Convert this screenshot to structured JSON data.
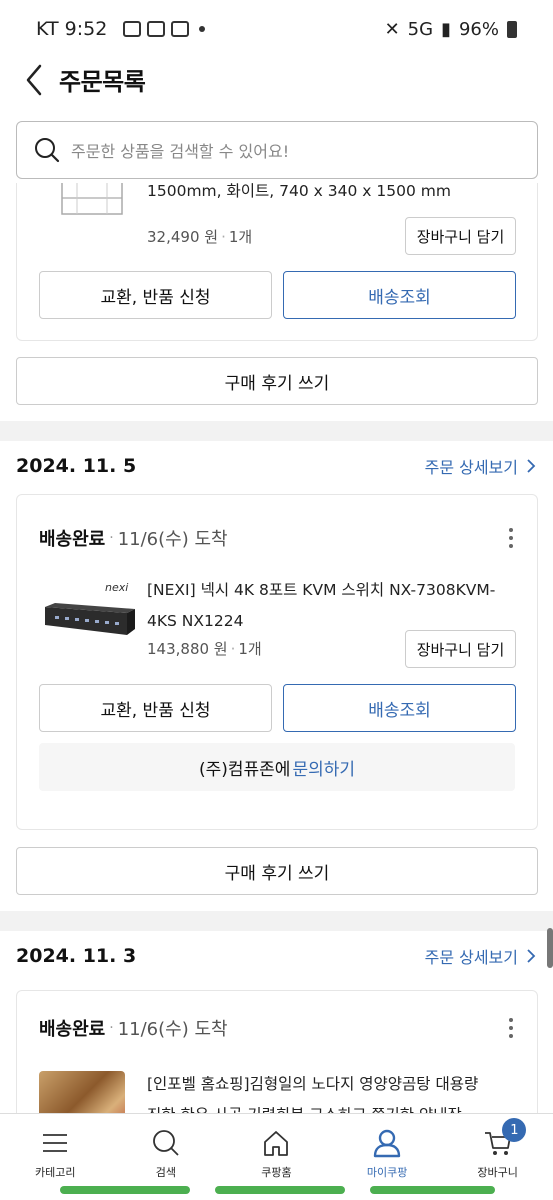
{
  "status_bar": {
    "carrier_time": "KT 9:52",
    "battery": "96%",
    "signal": "5G"
  },
  "header": {
    "title": "주문목록"
  },
  "search": {
    "placeholder": "주문한 상품을 검색할 수 있어요!"
  },
  "order_partial": {
    "product_name_tail": "1500mm, 화이트, 740 x 340 x 1500 mm",
    "price": "32,490 원",
    "qty": "1개",
    "cart_label": "장바구니 담기",
    "exchange_label": "교환, 반품 신청",
    "tracking_label": "배송조회",
    "review_label": "구매 후기 쓰기"
  },
  "order_1": {
    "date": "2024. 11. 5",
    "detail_label": "주문 상세보기",
    "status": "배송완료",
    "arrival": "11/6(수) 도착",
    "product_name_line1": "[NEXI] 넥시 4K 8포트 KVM 스위치 NX-7308KVM-",
    "product_name_line2": "4KS NX1224",
    "brand_logo": "nexi",
    "price": "143,880 원",
    "qty": "1개",
    "cart_label": "장바구니 담기",
    "exchange_label": "교환, 반품 신청",
    "tracking_label": "배송조회",
    "seller_text": "(주)컴퓨존에",
    "inquiry_link": "문의하기",
    "review_label": "구매 후기 쓰기"
  },
  "order_2": {
    "date": "2024. 11. 3",
    "detail_label": "주문 상세보기",
    "status": "배송완료",
    "arrival": "11/6(수) 도착",
    "product_name_line1": "[인포벨 홈쇼핑]김형일의 노다지 영양양곰탕 대용량",
    "product_name_line2": "진한 한우 사골 기력회복 고소하고 쫀기한 양내장"
  },
  "bottom_nav": {
    "items": [
      {
        "label": "카테고리",
        "icon": "menu-icon"
      },
      {
        "label": "검색",
        "icon": "search-icon"
      },
      {
        "label": "쿠팡홈",
        "icon": "home-icon"
      },
      {
        "label": "마이쿠팡",
        "icon": "user-icon"
      },
      {
        "label": "장바구니",
        "icon": "cart-icon"
      }
    ],
    "active_index": 3,
    "cart_badge": "1"
  },
  "colors": {
    "accent": "#356ab2",
    "gesture": "#4caf50"
  }
}
